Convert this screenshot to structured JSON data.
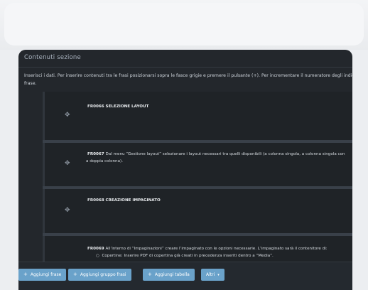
{
  "panel": {
    "title": "Contenuti sezione",
    "intro_line1": "Inserisci i dati. Per inserire contenuti tra le frasi posizionarsi sopra le fasce grigie e premere il pulsante (+). Per incrementare il numeratore degli indici s",
    "intro_line2": "frase."
  },
  "phrases": [
    {
      "code": "FR0066",
      "text": "SELEZIONE LAYOUT"
    },
    {
      "code": "FR0067",
      "text": "Dal menu “Gestione layout” selezionare i layout necessari tra quelli disponibili (a colonna singola, a colonna singola con",
      "text2": "a doppia colonna)."
    },
    {
      "code": "FR0068",
      "text": "CREAZIONE IMPAGINATO"
    },
    {
      "code": "FR0069",
      "text": "All’interno di “Impaginazioni” creare l’impaginato con le opzioni necessarie. L’impaginato sarà il contenitore di:",
      "bullet": "Copertine: Inserire PDF di copertina già creati in precedenza inseriti dentro a “Media”."
    }
  ],
  "footer": {
    "add_phrase": "Aggiungi frase",
    "add_group": "Aggiungi gruppo frasi",
    "add_table": "Aggiungi tabella",
    "others": "Altri"
  },
  "icons": {
    "drag": "move-handle-icon",
    "add": "plus-icon",
    "dropdown": "caret-down-icon"
  }
}
